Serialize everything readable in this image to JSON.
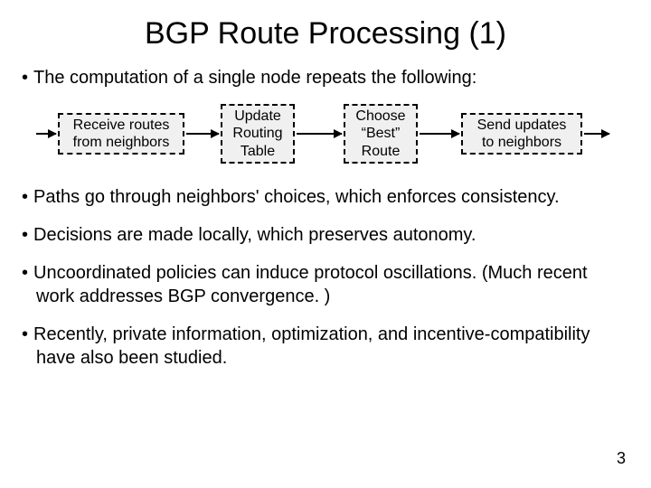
{
  "title": "BGP Route Processing (1)",
  "bullets": {
    "b1": "The computation of a single node repeats the following:",
    "b2": "Paths go through neighbors' choices, which enforces consistency.",
    "b3": "Decisions are made locally, which preserves autonomy.",
    "b4": "Uncoordinated policies can induce protocol oscillations. (Much recent work addresses BGP convergence. )",
    "b5": "Recently, private information, optimization, and incentive-compatibility have also been studied."
  },
  "boxes": {
    "box1": "Receive routes\nfrom neighbors",
    "box2": "Update\nRouting\nTable",
    "box3": "Choose\n“Best”\nRoute",
    "box4": "Send updates\nto neighbors"
  },
  "slide_number": "3"
}
